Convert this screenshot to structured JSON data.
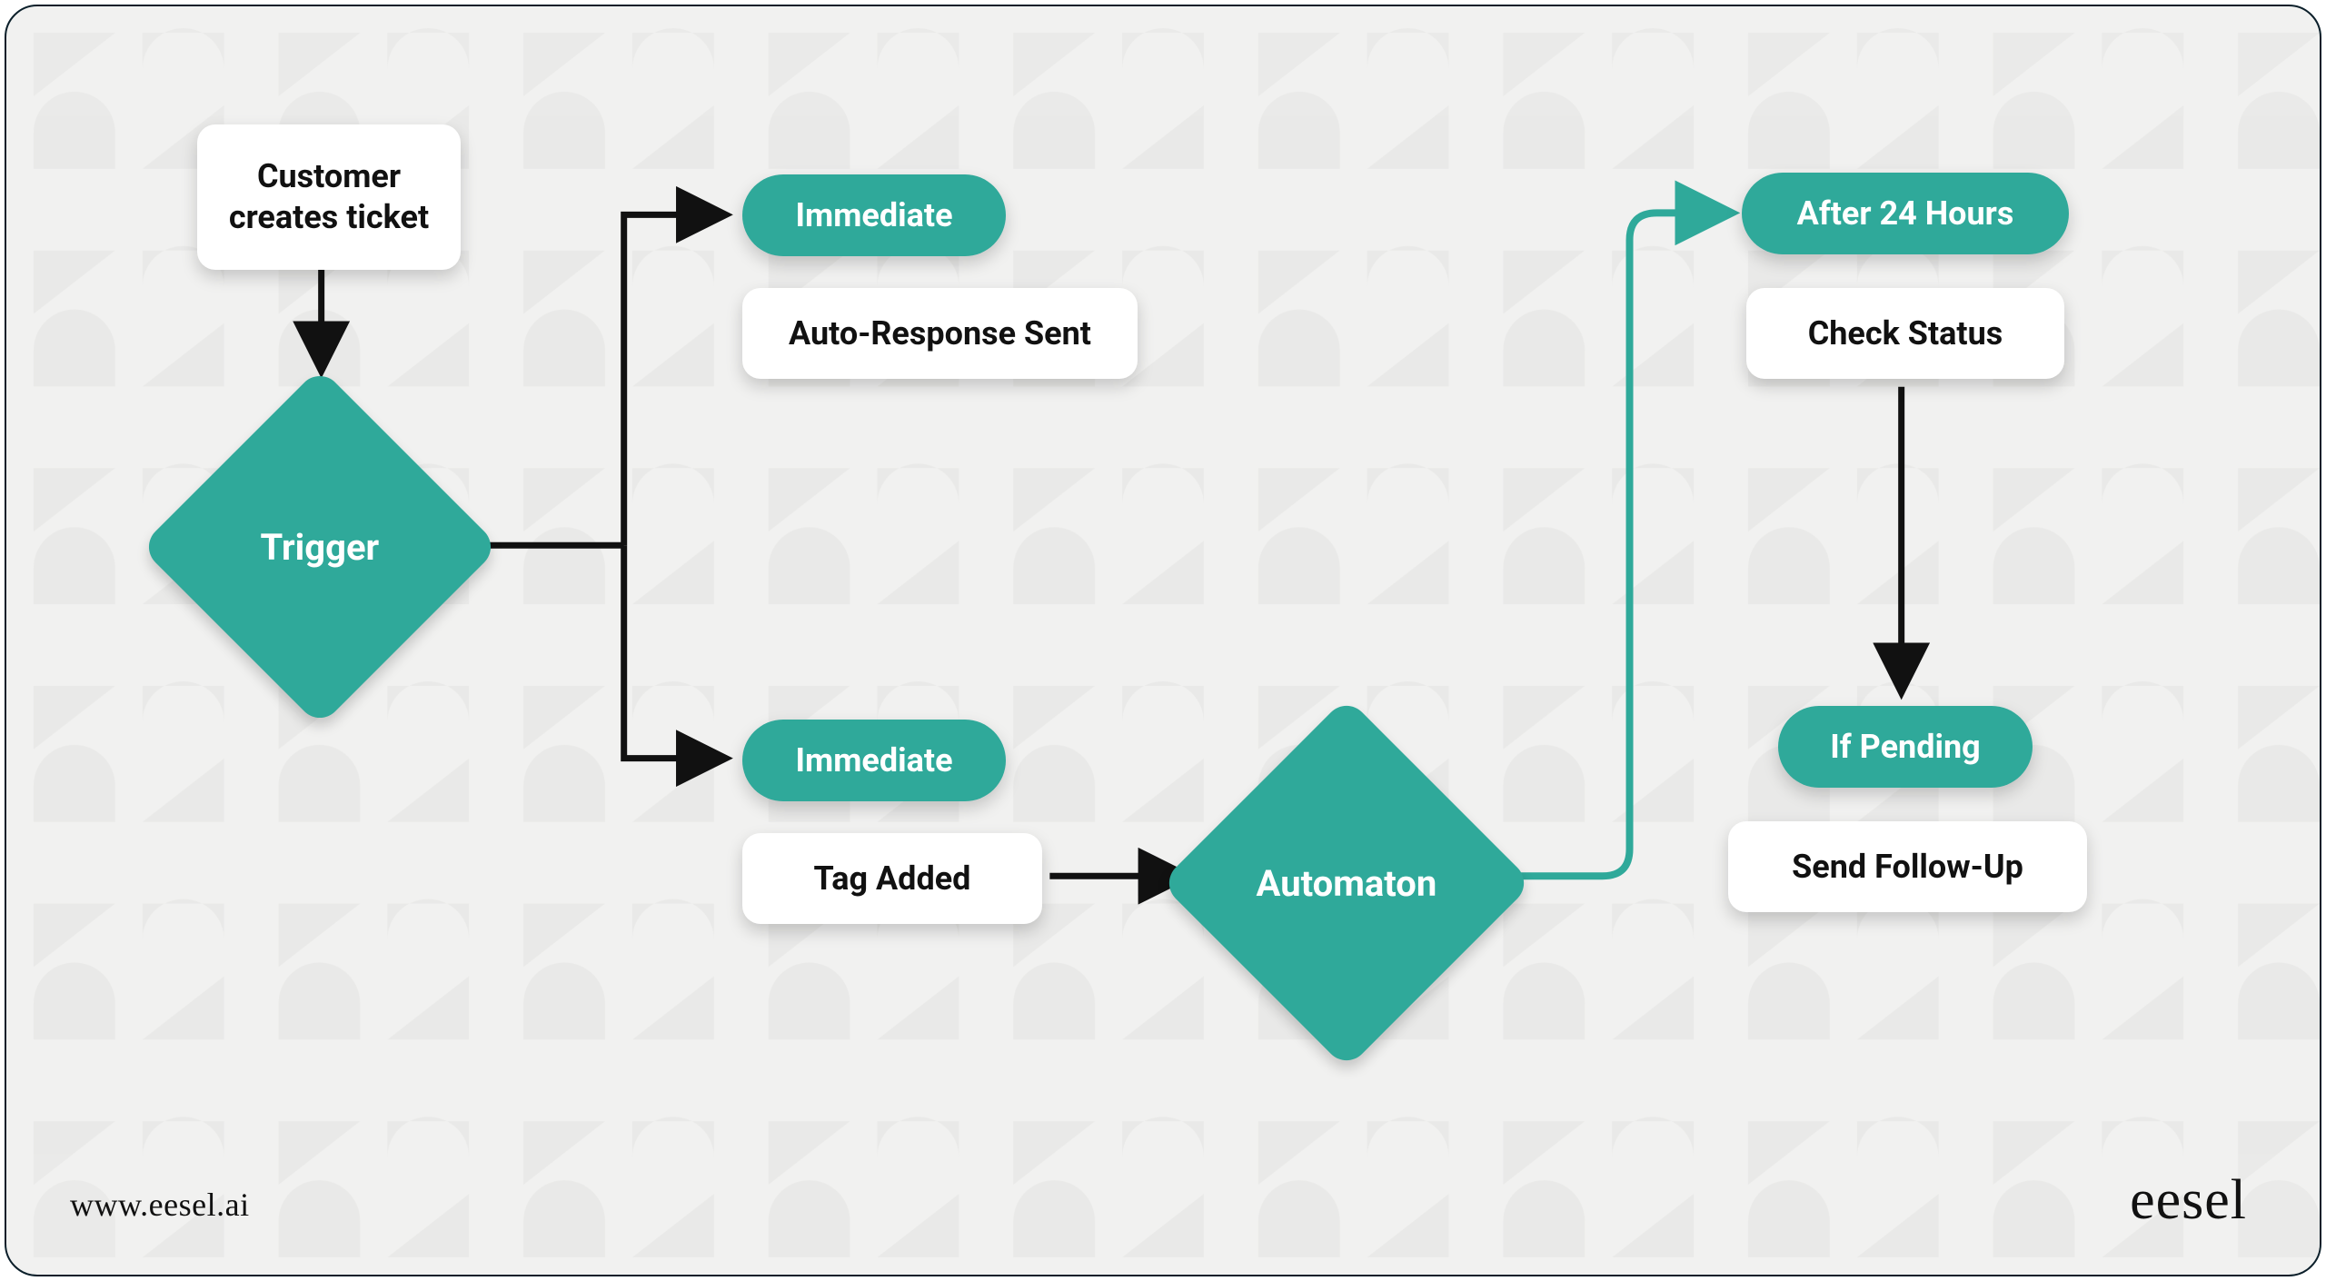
{
  "colors": {
    "teal": "#2FA99A",
    "bg": "#F1F1F0",
    "ink": "#111111",
    "patternStroke": "#E3E3E1"
  },
  "nodes": {
    "start": {
      "label": "Customer\ncreates ticket"
    },
    "trigger": {
      "label": "Trigger"
    },
    "immediate1": {
      "label": "Immediate"
    },
    "autoResponse": {
      "label": "Auto-Response Sent"
    },
    "immediate2": {
      "label": "Immediate"
    },
    "tagAdded": {
      "label": "Tag Added"
    },
    "automaton": {
      "label": "Automaton"
    },
    "after24": {
      "label": "After 24 Hours"
    },
    "checkStatus": {
      "label": "Check Status"
    },
    "ifPending": {
      "label": "If Pending"
    },
    "sendFollowUp": {
      "label": "Send Follow-Up"
    }
  },
  "footer": {
    "url": "www.eesel.ai",
    "brand": "eesel"
  }
}
